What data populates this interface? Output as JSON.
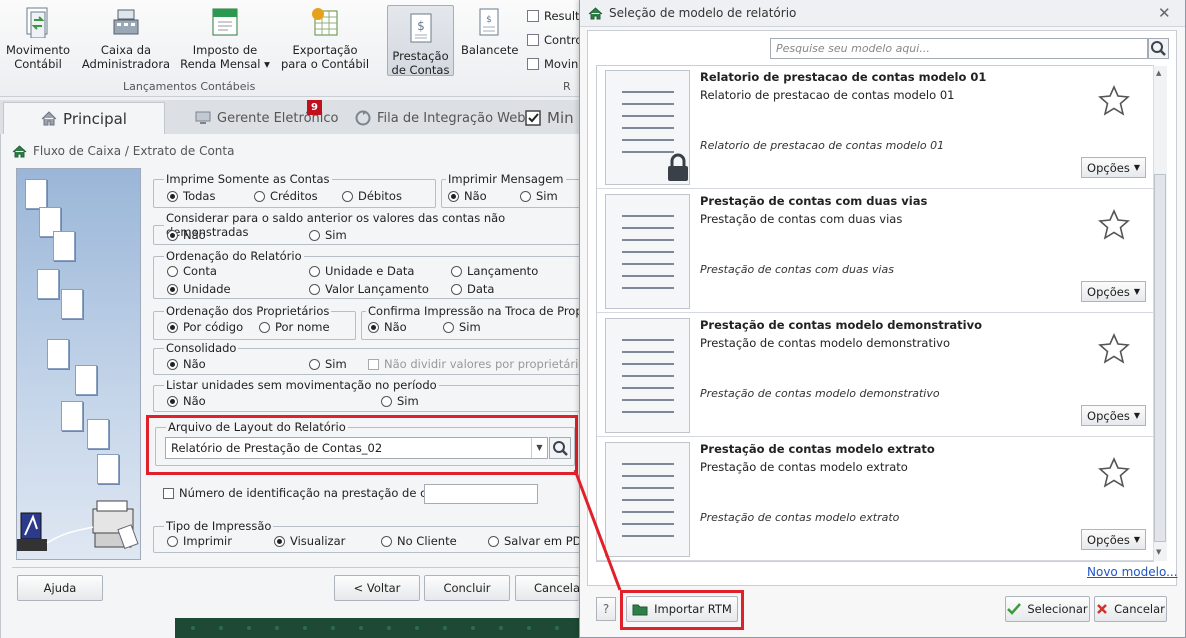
{
  "ribbon": {
    "buttons": [
      {
        "label1": "Movimento",
        "label2": "Contábil"
      },
      {
        "label1": "Caixa da",
        "label2": "Administradora"
      },
      {
        "label1": "Imposto de",
        "label2": "Renda Mensal ▾"
      },
      {
        "label1": "Exportação",
        "label2": "para o Contábil"
      },
      {
        "label1": "Prestação",
        "label2": "de Contas"
      },
      {
        "label1": "Balancete",
        "label2": ""
      }
    ],
    "group_label": "Lançamentos Contábeis",
    "group_label_2": "R",
    "small_items": [
      "Result",
      "Contro",
      "Movin"
    ]
  },
  "tabs": {
    "principal": "Principal",
    "gerente": "Gerente Eletrônico",
    "gerente_badge": "9",
    "fila": "Fila de Integração Web",
    "min": "Min"
  },
  "form": {
    "breadcrumb": "Fluxo de Caixa / Extrato de Conta",
    "imprime_contas": {
      "legend": "Imprime Somente as Contas",
      "opts": [
        "Todas",
        "Créditos",
        "Débitos"
      ]
    },
    "imprimir_mensagem": {
      "legend": "Imprimir Mensagem",
      "opts": [
        "Não",
        "Sim"
      ]
    },
    "considerar": {
      "legend": "Considerar para o saldo anterior os valores das contas não demonstradas",
      "opts": [
        "Não",
        "Sim"
      ]
    },
    "ordenacao": {
      "legend": "Ordenação do Relatório",
      "opts": [
        "Conta",
        "Unidade e Data",
        "Lançamento",
        "Unidade",
        "Valor Lançamento",
        "Data"
      ]
    },
    "ordenacao_prop": {
      "legend": "Ordenação dos Proprietários",
      "opts": [
        "Por código",
        "Por nome"
      ]
    },
    "confirma": {
      "legend": "Confirma Impressão na Troca de Proprietário",
      "opts": [
        "Não",
        "Sim"
      ]
    },
    "consolidado": {
      "legend": "Consolidado",
      "opts": [
        "Não",
        "Sim"
      ],
      "check": "Não dividir valores por proprietário"
    },
    "listar": {
      "legend": "Listar unidades sem movimentação no período",
      "opts": [
        "Não",
        "Sim"
      ]
    },
    "arquivo": {
      "legend": "Arquivo de Layout do Relatório",
      "value": "Relatório de Prestação de Contas_02"
    },
    "numero_id": "Número de identificação na prestação de contas:",
    "tipo": {
      "legend": "Tipo de Impressão",
      "opts": [
        "Imprimir",
        "Visualizar",
        "No Cliente",
        "Salvar em PDF"
      ]
    },
    "buttons": {
      "ajuda": "Ajuda",
      "voltar": "< Voltar",
      "concluir": "Concluir",
      "cancelar": "Cancelar"
    }
  },
  "dialog": {
    "title": "Seleção de modelo de relatório",
    "search_placeholder": "Pesquise seu modelo aqui...",
    "items": [
      {
        "title": "Relatorio de prestacao de contas modelo 01",
        "sub": "Relatorio de prestacao de contas modelo 01",
        "desc": "Relatorio de prestacao de contas modelo 01",
        "locked": true
      },
      {
        "title": "Prestação de contas com duas vias",
        "sub": "Prestação de contas com duas vias",
        "desc": "Prestação de contas com duas vias",
        "locked": false
      },
      {
        "title": "Prestação de contas modelo demonstrativo",
        "sub": "Prestação de contas modelo demonstrativo",
        "desc": "Prestação de contas modelo demonstrativo",
        "locked": false
      },
      {
        "title": "Prestação de contas modelo extrato",
        "sub": "Prestação de contas modelo extrato",
        "desc": "Prestação de contas modelo extrato",
        "locked": false
      }
    ],
    "options_label": "Opções",
    "novo_modelo": "Novo modelo...",
    "help": "?",
    "importar": "Importar RTM",
    "selecionar": "Selecionar",
    "cancelar": "Cancelar"
  },
  "colors": {
    "highlight": "#e0202a",
    "accent_green": "#1e4a35",
    "link": "#1f56c6"
  }
}
